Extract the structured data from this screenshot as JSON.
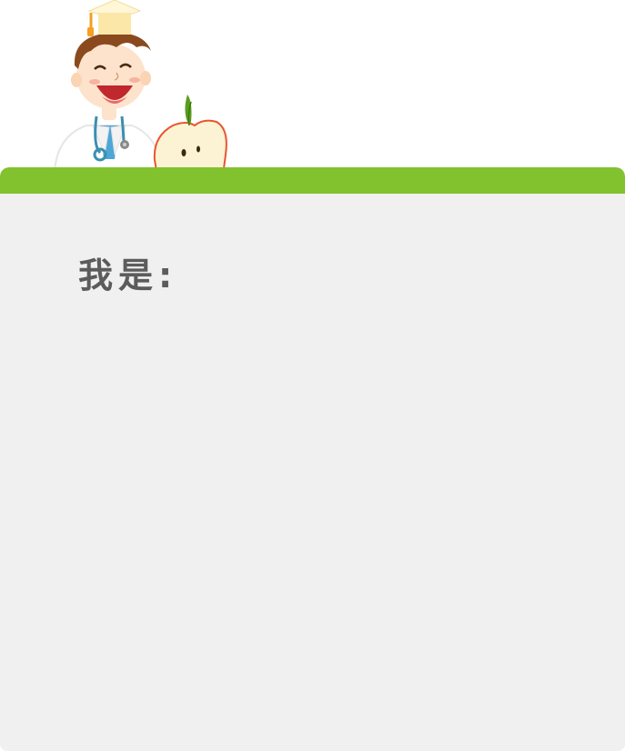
{
  "illustration": {
    "characters": [
      "doctor-mascot-icon",
      "apple-icon",
      "graduation-cap-icon"
    ]
  },
  "header": {
    "accent_color": "#82c22e"
  },
  "content": {
    "identity_label": "我是:",
    "background_color": "#f0f0f0"
  }
}
